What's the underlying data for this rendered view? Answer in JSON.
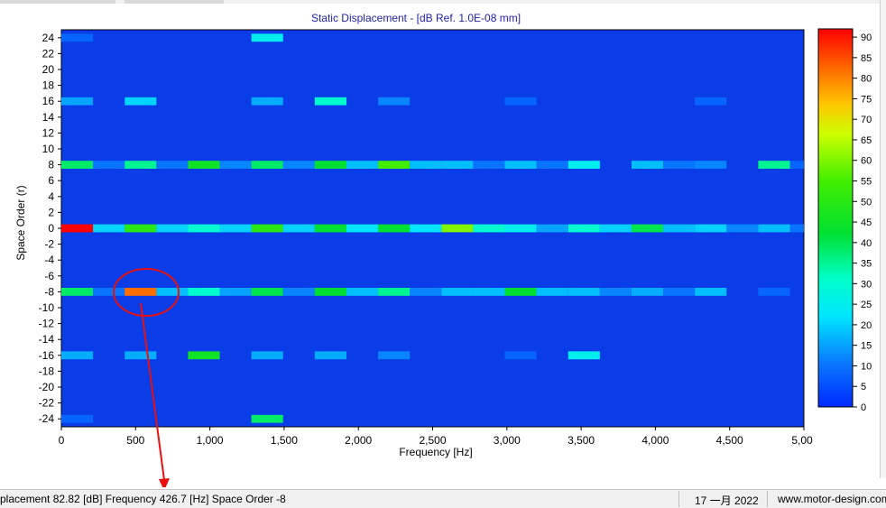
{
  "status": {
    "readout": "placement 82.82 [dB]  Frequency 426.7 [Hz]  Space Order -8",
    "date": "17 一月 2022",
    "website": "www.motor-design.com"
  },
  "chart_data": {
    "type": "heatmap",
    "title": "Static Displacement - [dB Ref. 1.0E-08 mm]",
    "xlabel": "Frequency [Hz]",
    "ylabel": "Space Order (r)",
    "xlim": [
      0,
      5000
    ],
    "ylim": [
      -25,
      25
    ],
    "x_ticks": [
      0,
      500,
      1000,
      1500,
      2000,
      2500,
      3000,
      3500,
      4000,
      4500,
      5000
    ],
    "x_tick_labels": [
      "0",
      "500",
      "1,000",
      "1,500",
      "2,000",
      "2,500",
      "3,000",
      "3,500",
      "4,000",
      "4,500",
      "5,00"
    ],
    "y_ticks": [
      24,
      22,
      20,
      18,
      16,
      14,
      12,
      10,
      8,
      6,
      4,
      2,
      0,
      -2,
      -4,
      -6,
      -8,
      -10,
      -12,
      -14,
      -16,
      -18,
      -20,
      -22,
      -24
    ],
    "colorbar": {
      "min": 0,
      "max": 92,
      "ticks": [
        0,
        5,
        10,
        15,
        20,
        25,
        30,
        35,
        40,
        45,
        50,
        55,
        60,
        65,
        70,
        75,
        80,
        85,
        90
      ]
    },
    "background_value": 0,
    "bin_width_hz": 213.3,
    "frequency_bins": [
      106.7,
      320.0,
      533.3,
      746.7,
      960.0,
      1173.3,
      1386.7,
      1600.0,
      1813.3,
      2026.7,
      2240.0,
      2453.3,
      2666.7,
      2880.0,
      3093.3,
      3306.7,
      3520.0,
      3733.3,
      3946.7,
      4160.0,
      4373.3,
      4586.7,
      4800.0
    ],
    "series": [
      {
        "name": "24",
        "values": [
          8,
          0,
          0,
          0,
          0,
          0,
          25,
          0,
          0,
          0,
          0,
          0,
          0,
          0,
          0,
          0,
          0,
          0,
          0,
          0,
          0,
          0,
          0
        ]
      },
      {
        "name": "16",
        "values": [
          15,
          0,
          20,
          0,
          0,
          0,
          16,
          0,
          30,
          0,
          12,
          0,
          0,
          0,
          8,
          0,
          0,
          0,
          0,
          0,
          8,
          0,
          0
        ]
      },
      {
        "name": "8",
        "values": [
          38,
          10,
          35,
          10,
          45,
          12,
          38,
          12,
          42,
          18,
          55,
          18,
          18,
          10,
          18,
          10,
          25,
          0,
          18,
          10,
          12,
          0,
          35,
          8
        ]
      },
      {
        "name": "0",
        "values": [
          92,
          20,
          50,
          20,
          30,
          20,
          50,
          20,
          42,
          22,
          42,
          22,
          60,
          30,
          25,
          15,
          30,
          20,
          40,
          18,
          20,
          12,
          18,
          10
        ]
      },
      {
        "name": "-8",
        "values": [
          38,
          10,
          82,
          18,
          30,
          15,
          40,
          12,
          42,
          18,
          35,
          12,
          18,
          18,
          42,
          18,
          18,
          12,
          16,
          10,
          18,
          0,
          8
        ]
      },
      {
        "name": "-16",
        "values": [
          16,
          0,
          16,
          0,
          45,
          0,
          16,
          0,
          16,
          0,
          12,
          0,
          0,
          0,
          8,
          0,
          25,
          0,
          0,
          0,
          0,
          0,
          0
        ]
      },
      {
        "name": "-24",
        "values": [
          8,
          0,
          0,
          0,
          0,
          0,
          38,
          0,
          0,
          0,
          0,
          0,
          0,
          0,
          0,
          0,
          0,
          0,
          0,
          0,
          0,
          0,
          0
        ]
      }
    ],
    "highlight": {
      "frequency": 426.7,
      "space_order": -8,
      "value": 82.82
    },
    "grid": false,
    "legend": "colorbar-right"
  }
}
